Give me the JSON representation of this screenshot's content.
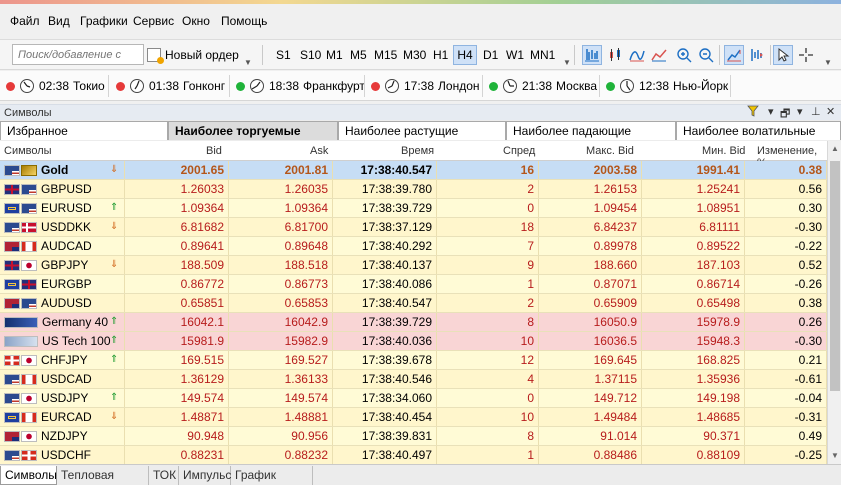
{
  "menu": [
    "Файл",
    "Вид",
    "Графики",
    "Сервис",
    "Окно",
    "Помощь"
  ],
  "toolbar": {
    "search_placeholder": "Поиск/добавление с",
    "new_order": "Новый ордер",
    "timeframes": [
      "S1",
      "S10",
      "M1",
      "M5",
      "M15",
      "M30",
      "H1",
      "H4",
      "D1",
      "W1",
      "MN1"
    ],
    "active_timeframe": "H4"
  },
  "clocks": [
    {
      "time": "02:38",
      "city": "Токио",
      "status": "red"
    },
    {
      "time": "01:38",
      "city": "Гонконг",
      "status": "red"
    },
    {
      "time": "18:38",
      "city": "Франкфурт",
      "status": "green"
    },
    {
      "time": "17:38",
      "city": "Лондон",
      "status": "red"
    },
    {
      "time": "21:38",
      "city": "Москва",
      "status": "green"
    },
    {
      "time": "12:38",
      "city": "Нью-Йорк",
      "status": "green"
    }
  ],
  "panel": {
    "title": "Символы"
  },
  "tabs": [
    "Избранное",
    "Наиболее торгуемые",
    "Наиболее растущие",
    "Наиболее падающие",
    "Наиболее волатильные"
  ],
  "active_tab": "Наиболее торгуемые",
  "columns": [
    "Символы",
    "Bid",
    "Ask",
    "Время",
    "Спред",
    "Макс. Bid",
    "Мин. Bid",
    "Изменение, %"
  ],
  "rows": [
    {
      "symbol": "Gold",
      "bid": "2001.65",
      "ask": "2001.81",
      "time": "17:38:40.547",
      "spread": "16",
      "max": "2003.58",
      "min": "1991.41",
      "change": "0.38",
      "trend": "down",
      "flag": "us-gold",
      "style": "selected"
    },
    {
      "symbol": "GBPUSD",
      "bid": "1.26033",
      "ask": "1.26035",
      "time": "17:38:39.780",
      "spread": "2",
      "max": "1.26153",
      "min": "1.25241",
      "change": "0.56",
      "trend": "",
      "flag": "gb-us",
      "style": "yellow"
    },
    {
      "symbol": "EURUSD",
      "bid": "1.09364",
      "ask": "1.09364",
      "time": "17:38:39.729",
      "spread": "0",
      "max": "1.09454",
      "min": "1.08951",
      "change": "0.30",
      "trend": "up",
      "flag": "eu-us",
      "style": "yellow"
    },
    {
      "symbol": "USDDKK",
      "bid": "6.81682",
      "ask": "6.81700",
      "time": "17:38:37.129",
      "spread": "18",
      "max": "6.84237",
      "min": "6.81111",
      "change": "-0.30",
      "trend": "down",
      "flag": "us-dk",
      "style": "yellow"
    },
    {
      "symbol": "AUDCAD",
      "bid": "0.89641",
      "ask": "0.89648",
      "time": "17:38:40.292",
      "spread": "7",
      "max": "0.89978",
      "min": "0.89522",
      "change": "-0.22",
      "trend": "",
      "flag": "au-ca",
      "style": "yellow"
    },
    {
      "symbol": "GBPJPY",
      "bid": "188.509",
      "ask": "188.518",
      "time": "17:38:40.137",
      "spread": "9",
      "max": "188.660",
      "min": "187.103",
      "change": "0.52",
      "trend": "down",
      "flag": "gb-jp",
      "style": "yellow"
    },
    {
      "symbol": "EURGBP",
      "bid": "0.86772",
      "ask": "0.86773",
      "time": "17:38:40.086",
      "spread": "1",
      "max": "0.87071",
      "min": "0.86714",
      "change": "-0.26",
      "trend": "",
      "flag": "eu-gb",
      "style": "yellow"
    },
    {
      "symbol": "AUDUSD",
      "bid": "0.65851",
      "ask": "0.65853",
      "time": "17:38:40.547",
      "spread": "2",
      "max": "0.65909",
      "min": "0.65498",
      "change": "0.38",
      "trend": "",
      "flag": "au-us",
      "style": "yellow"
    },
    {
      "symbol": "Germany 40",
      "bid": "16042.1",
      "ask": "16042.9",
      "time": "17:38:39.729",
      "spread": "8",
      "max": "16050.9",
      "min": "15978.9",
      "change": "0.26",
      "trend": "up",
      "flag": "dax",
      "style": "pink"
    },
    {
      "symbol": "US Tech 100",
      "bid": "15981.9",
      "ask": "15982.9",
      "time": "17:38:40.036",
      "spread": "10",
      "max": "16036.5",
      "min": "15948.3",
      "change": "-0.30",
      "trend": "up",
      "flag": "nasdaq",
      "style": "pink"
    },
    {
      "symbol": "CHFJPY",
      "bid": "169.515",
      "ask": "169.527",
      "time": "17:38:39.678",
      "spread": "12",
      "max": "169.645",
      "min": "168.825",
      "change": "0.21",
      "trend": "up",
      "flag": "ch-jp",
      "style": "yellow"
    },
    {
      "symbol": "USDCAD",
      "bid": "1.36129",
      "ask": "1.36133",
      "time": "17:38:40.546",
      "spread": "4",
      "max": "1.37115",
      "min": "1.35936",
      "change": "-0.61",
      "trend": "",
      "flag": "us-ca",
      "style": "yellow"
    },
    {
      "symbol": "USDJPY",
      "bid": "149.574",
      "ask": "149.574",
      "time": "17:38:34.060",
      "spread": "0",
      "max": "149.712",
      "min": "149.198",
      "change": "-0.04",
      "trend": "up",
      "flag": "us-jp",
      "style": "yellow"
    },
    {
      "symbol": "EURCAD",
      "bid": "1.48871",
      "ask": "1.48881",
      "time": "17:38:40.454",
      "spread": "10",
      "max": "1.49484",
      "min": "1.48685",
      "change": "-0.31",
      "trend": "down",
      "flag": "eu-ca",
      "style": "yellow"
    },
    {
      "symbol": "NZDJPY",
      "bid": "90.948",
      "ask": "90.956",
      "time": "17:38:39.831",
      "spread": "8",
      "max": "91.014",
      "min": "90.371",
      "change": "0.49",
      "trend": "",
      "flag": "nz-jp",
      "style": "yellow"
    },
    {
      "symbol": "USDCHF",
      "bid": "0.88231",
      "ask": "0.88232",
      "time": "17:38:40.497",
      "spread": "1",
      "max": "0.88486",
      "min": "0.88109",
      "change": "-0.25",
      "trend": "",
      "flag": "us-ch",
      "style": "yellow"
    }
  ],
  "bottom_tabs": [
    "Символы",
    "Тепловая карта",
    "ТОК",
    "Импульс",
    "График тиков"
  ],
  "active_bottom_tab": "Символы",
  "colors": {
    "row_yellow": "#fffbd6",
    "row_yellow_alt": "#fff6cc",
    "row_pink": "#f9d5d5",
    "row_selected": "#c6ddf5",
    "num_red": "#b71c1c",
    "num_orange": "#b4561a",
    "green_dot": "#1fb33a",
    "red_dot": "#e63a3a"
  }
}
